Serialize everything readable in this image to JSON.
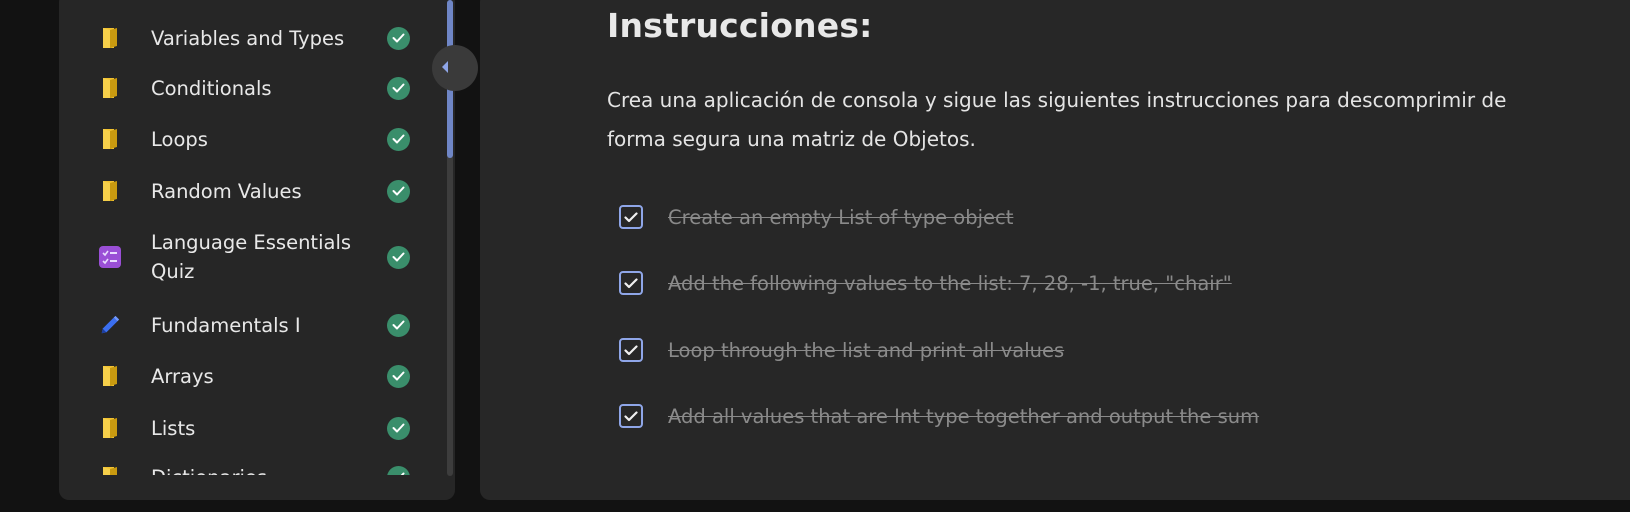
{
  "sidebar": {
    "items": [
      {
        "label": "Variables and Types",
        "icon": "book-icon",
        "done": true
      },
      {
        "label": "Conditionals",
        "icon": "book-icon",
        "done": true
      },
      {
        "label": "Loops",
        "icon": "book-icon",
        "done": true
      },
      {
        "label": "Random Values",
        "icon": "book-icon",
        "done": true
      },
      {
        "label": "Language Essentials Quiz",
        "icon": "quiz-icon",
        "done": true
      },
      {
        "label": "Fundamentals I",
        "icon": "pencil-icon",
        "done": true
      },
      {
        "label": "Arrays",
        "icon": "book-icon",
        "done": true
      },
      {
        "label": "Lists",
        "icon": "book-icon",
        "done": true
      },
      {
        "label": "Dictionaries",
        "icon": "book-icon",
        "done": true
      }
    ]
  },
  "main": {
    "title": "Instrucciones:",
    "description": "Crea una aplicación de consola y sigue las siguientes instrucciones para descomprimir de forma segura una matriz de Objetos.",
    "tasks": [
      {
        "text": "Create an empty List of type object",
        "checked": true
      },
      {
        "text": "Add the following values to the list: 7, 28, -1, true, \"chair\"",
        "checked": true
      },
      {
        "text": "Loop through the list and print all values",
        "checked": true
      },
      {
        "text": "Add all values that are Int type together and output the sum",
        "checked": true
      }
    ]
  },
  "colors": {
    "book": "#f2c230",
    "quiz": "#9a4fd6",
    "pencil": "#3b6ff0",
    "check_badge": "#3a8e6b",
    "checkbox_border": "#8fa6e8",
    "scroll_thumb": "#6f86c6"
  }
}
